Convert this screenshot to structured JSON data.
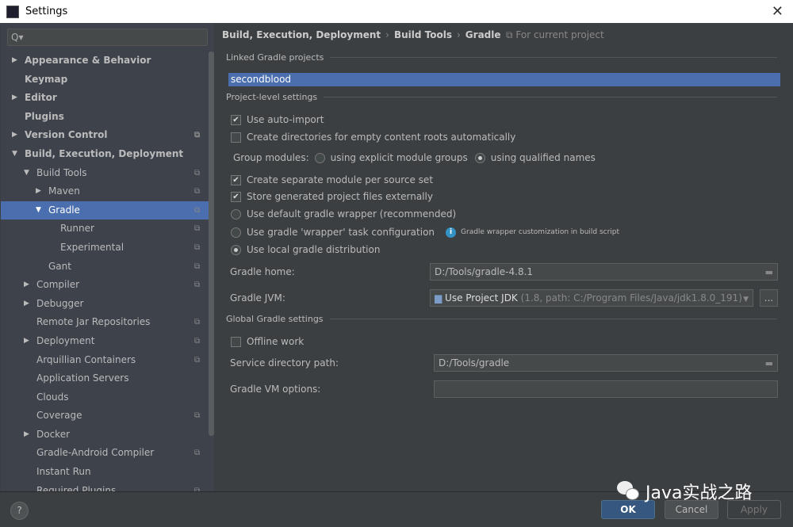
{
  "window": {
    "title": "Settings",
    "logo": "IJ"
  },
  "search": {
    "placeholder": "Q▾"
  },
  "tree": [
    {
      "label": "Appearance & Behavior",
      "level": 0,
      "arrow": "▶",
      "bold": true,
      "cfg": false
    },
    {
      "label": "Keymap",
      "level": 0,
      "arrow": "",
      "bold": true,
      "cfg": false
    },
    {
      "label": "Editor",
      "level": 0,
      "arrow": "▶",
      "bold": true,
      "cfg": false
    },
    {
      "label": "Plugins",
      "level": 0,
      "arrow": "",
      "bold": true,
      "cfg": false
    },
    {
      "label": "Version Control",
      "level": 0,
      "arrow": "▶",
      "bold": true,
      "cfg": true
    },
    {
      "label": "Build, Execution, Deployment",
      "level": 0,
      "arrow": "▼",
      "bold": true,
      "cfg": false
    },
    {
      "label": "Build Tools",
      "level": 1,
      "arrow": "▼",
      "bold": false,
      "cfg": true
    },
    {
      "label": "Maven",
      "level": 2,
      "arrow": "▶",
      "bold": false,
      "cfg": true
    },
    {
      "label": "Gradle",
      "level": 2,
      "arrow": "▼",
      "bold": false,
      "cfg": true,
      "selected": true
    },
    {
      "label": "Runner",
      "level": 3,
      "arrow": "",
      "bold": false,
      "cfg": true
    },
    {
      "label": "Experimental",
      "level": 3,
      "arrow": "",
      "bold": false,
      "cfg": true
    },
    {
      "label": "Gant",
      "level": 2,
      "arrow": "",
      "bold": false,
      "cfg": true
    },
    {
      "label": "Compiler",
      "level": 1,
      "arrow": "▶",
      "bold": false,
      "cfg": true
    },
    {
      "label": "Debugger",
      "level": 1,
      "arrow": "▶",
      "bold": false,
      "cfg": false
    },
    {
      "label": "Remote Jar Repositories",
      "level": 1,
      "arrow": "",
      "bold": false,
      "cfg": true
    },
    {
      "label": "Deployment",
      "level": 1,
      "arrow": "▶",
      "bold": false,
      "cfg": true
    },
    {
      "label": "Arquillian Containers",
      "level": 1,
      "arrow": "",
      "bold": false,
      "cfg": true
    },
    {
      "label": "Application Servers",
      "level": 1,
      "arrow": "",
      "bold": false,
      "cfg": false
    },
    {
      "label": "Clouds",
      "level": 1,
      "arrow": "",
      "bold": false,
      "cfg": false
    },
    {
      "label": "Coverage",
      "level": 1,
      "arrow": "",
      "bold": false,
      "cfg": true
    },
    {
      "label": "Docker",
      "level": 1,
      "arrow": "▶",
      "bold": false,
      "cfg": false
    },
    {
      "label": "Gradle-Android Compiler",
      "level": 1,
      "arrow": "",
      "bold": false,
      "cfg": true
    },
    {
      "label": "Instant Run",
      "level": 1,
      "arrow": "",
      "bold": false,
      "cfg": false
    },
    {
      "label": "Required Plugins",
      "level": 1,
      "arrow": "",
      "bold": false,
      "cfg": true
    }
  ],
  "breadcrumb": [
    "Build, Execution, Deployment",
    "Build Tools",
    "Gradle"
  ],
  "scope": "For current project",
  "linked": {
    "header": "Linked Gradle projects",
    "project": "secondblood"
  },
  "project_level": {
    "header": "Project-level settings",
    "auto_import": "Use auto-import",
    "create_dirs": "Create directories for empty content roots automatically",
    "group_modules": "Group modules:",
    "explicit": "using explicit module groups",
    "qualified": "using qualified names",
    "separate_module": "Create separate module per source set",
    "store_external": "Store generated project files externally",
    "default_wrapper": "Use default gradle wrapper (recommended)",
    "wrapper_task": "Use gradle 'wrapper' task configuration",
    "wrapper_hint": "Gradle wrapper customization in build script",
    "local_dist": "Use local gradle distribution",
    "gradle_home_label": "Gradle home:",
    "gradle_home": "D:/Tools/gradle-4.8.1",
    "gradle_jvm_label": "Gradle JVM:",
    "gradle_jvm": "Use Project JDK",
    "gradle_jvm_detail": "(1.8, path: C:/Program Files/Java/jdk1.8.0_191)",
    "more": "..."
  },
  "global": {
    "header": "Global Gradle settings",
    "offline": "Offline work",
    "service_label": "Service directory path:",
    "service": "D:/Tools/gradle",
    "vm_label": "Gradle VM options:",
    "vm": ""
  },
  "footer": {
    "help": "?",
    "ok": "OK",
    "cancel": "Cancel",
    "apply": "Apply"
  },
  "watermark": "Java实战之路"
}
